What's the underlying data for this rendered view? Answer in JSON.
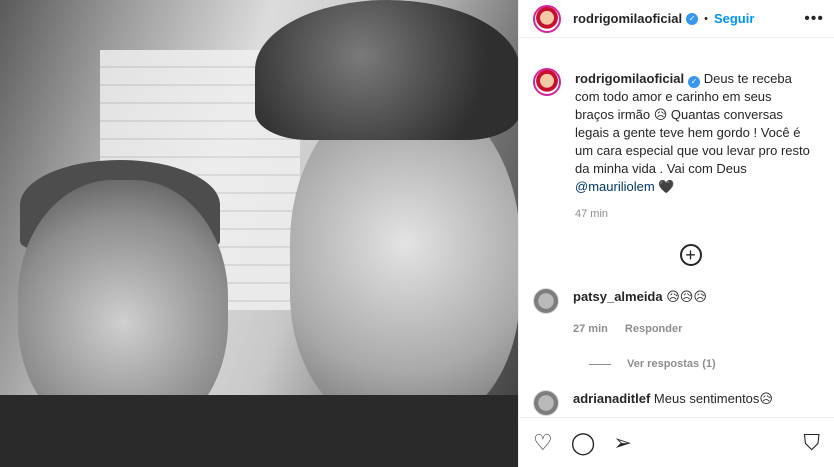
{
  "post": {
    "username": "rodrigomilaoficial",
    "verified_icon": "verified-badge-icon",
    "dot": "•",
    "follow_label": "Seguir",
    "more_icon": "•••"
  },
  "caption": {
    "username": "rodrigomilaoficial",
    "text": "Deus te receba com todo amor e carinho em seus braços irmão 😥 Quantas conversas legais a gente teve hem gordo ! Você é um cara especial que vou levar pro resto da minha vida . Vai com Deus",
    "mention": "@mauriliolem",
    "emoji_end": "🖤",
    "time": "47 min"
  },
  "add_icon": "+",
  "comments": [
    {
      "username": "patsy_almeida",
      "text": "😥😥😥",
      "time": "27 min",
      "reply_label": "Responder",
      "view_replies": "Ver respostas (1)"
    },
    {
      "username": "adrianaditlef",
      "text": "Meus sentimentos😥"
    }
  ],
  "actions": {
    "like_icon": "♡",
    "comment_icon": "◯",
    "share_icon": "➢",
    "save_icon": "⛉"
  },
  "colors": {
    "accent": "#0095f6",
    "verified": "#3897f0",
    "secondary_text": "#8e8e8e"
  }
}
